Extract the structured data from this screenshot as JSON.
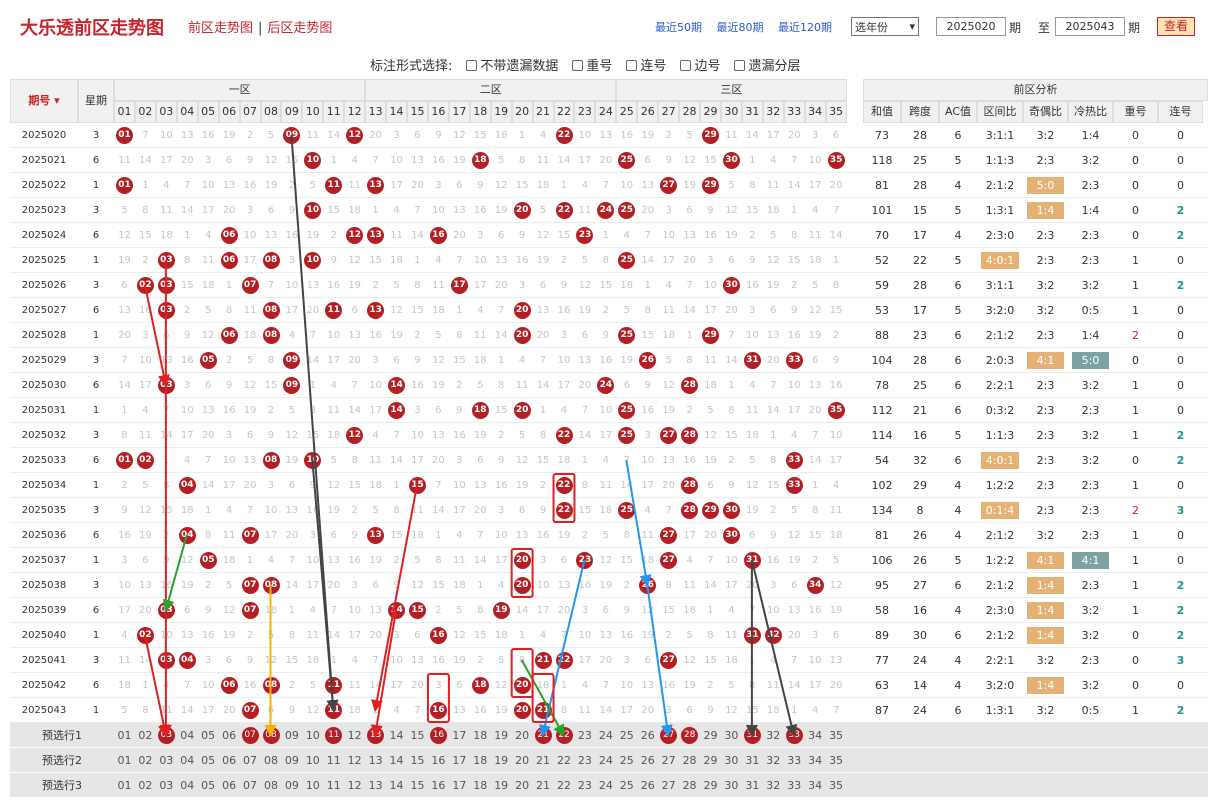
{
  "brand": "大乐透前区走势图",
  "nav": {
    "front": "前区走势图",
    "back": "后区走势图"
  },
  "quick": [
    "最近50期",
    "最近80期",
    "最近120期"
  ],
  "year_select": "选年份",
  "range": {
    "from": "2025020",
    "from_label": "期",
    "to_label": "至",
    "to": "2025043",
    "to_suffix": "期"
  },
  "view_button": "查看",
  "options": {
    "label": "标注形式选择:",
    "items": [
      "不带遗漏数据",
      "重号",
      "连号",
      "边号",
      "遗漏分层"
    ]
  },
  "header": {
    "period": "期号",
    "weekday": "星期",
    "zone1": "一区",
    "zone2": "二区",
    "zone3": "三区",
    "analysis": "前区分析",
    "numbers": [
      "01",
      "02",
      "03",
      "04",
      "05",
      "06",
      "07",
      "08",
      "09",
      "10",
      "11",
      "12",
      "13",
      "14",
      "15",
      "16",
      "17",
      "18",
      "19",
      "20",
      "21",
      "22",
      "23",
      "24",
      "25",
      "26",
      "27",
      "28",
      "29",
      "30",
      "31",
      "32",
      "33",
      "34",
      "35"
    ],
    "cols": [
      "和值",
      "跨度",
      "AC值",
      "区间比",
      "奇偶比",
      "冷热比",
      "重号",
      "连号"
    ]
  },
  "rows": [
    {
      "p": "2025020",
      "w": "3",
      "b": [
        1,
        9,
        12,
        22,
        29
      ],
      "a": [
        "73",
        "28",
        "6",
        "3:1:1",
        "3:2",
        "1:4",
        "0",
        "0"
      ]
    },
    {
      "p": "2025021",
      "w": "6",
      "b": [
        10,
        18,
        25,
        30,
        35
      ],
      "a": [
        "118",
        "25",
        "5",
        "1:1:3",
        "2:3",
        "3:2",
        "0",
        "0"
      ]
    },
    {
      "p": "2025022",
      "w": "1",
      "b": [
        1,
        11,
        13,
        27,
        29
      ],
      "a": [
        "81",
        "28",
        "4",
        "2:1:2",
        "5:0",
        "2:3",
        "0",
        "0"
      ]
    },
    {
      "p": "2025023",
      "w": "3",
      "b": [
        10,
        20,
        22,
        24,
        25
      ],
      "a": [
        "101",
        "15",
        "5",
        "1:3:1",
        "1:4",
        "1:4",
        "0",
        "2"
      ]
    },
    {
      "p": "2025024",
      "w": "6",
      "b": [
        6,
        12,
        13,
        16,
        23
      ],
      "a": [
        "70",
        "17",
        "4",
        "2:3:0",
        "2:3",
        "2:3",
        "0",
        "2"
      ]
    },
    {
      "p": "2025025",
      "w": "1",
      "b": [
        3,
        6,
        8,
        10,
        25
      ],
      "a": [
        "52",
        "22",
        "5",
        "4:0:1",
        "2:3",
        "2:3",
        "1",
        "0"
      ]
    },
    {
      "p": "2025026",
      "w": "3",
      "b": [
        2,
        7,
        17,
        30,
        3
      ],
      "a": [
        "59",
        "28",
        "6",
        "3:1:1",
        "3:2",
        "3:2",
        "1",
        "2"
      ]
    },
    {
      "p": "2025027",
      "w": "6",
      "b": [
        3,
        8,
        11,
        13,
        20
      ],
      "a": [
        "53",
        "17",
        "5",
        "3:2:0",
        "3:2",
        "0:5",
        "1",
        "0"
      ]
    },
    {
      "p": "2025028",
      "w": "1",
      "b": [
        6,
        8,
        20,
        25,
        29
      ],
      "a": [
        "88",
        "23",
        "6",
        "2:1:2",
        "2:3",
        "1:4",
        "2",
        "0"
      ]
    },
    {
      "p": "2025029",
      "w": "3",
      "b": [
        5,
        9,
        26,
        31,
        33
      ],
      "a": [
        "104",
        "28",
        "6",
        "2:0:3",
        "4:1",
        "5:0",
        "0",
        "0"
      ]
    },
    {
      "p": "2025030",
      "w": "6",
      "b": [
        3,
        9,
        14,
        24,
        28
      ],
      "a": [
        "78",
        "25",
        "6",
        "2:2:1",
        "2:3",
        "3:2",
        "1",
        "0"
      ]
    },
    {
      "p": "2025031",
      "w": "1",
      "b": [
        14,
        18,
        20,
        25,
        35
      ],
      "a": [
        "112",
        "21",
        "6",
        "0:3:2",
        "2:3",
        "2:3",
        "1",
        "0"
      ]
    },
    {
      "p": "2025032",
      "w": "3",
      "b": [
        12,
        22,
        25,
        27,
        28
      ],
      "a": [
        "114",
        "16",
        "5",
        "1:1:3",
        "2:3",
        "3:2",
        "1",
        "2"
      ]
    },
    {
      "p": "2025033",
      "w": "6",
      "b": [
        1,
        2,
        8,
        10,
        33
      ],
      "a": [
        "54",
        "32",
        "6",
        "4:0:1",
        "2:3",
        "3:2",
        "0",
        "2"
      ]
    },
    {
      "p": "2025034",
      "w": "1",
      "b": [
        4,
        15,
        22,
        28,
        33
      ],
      "a": [
        "102",
        "29",
        "4",
        "1:2:2",
        "2:3",
        "2:3",
        "1",
        "0"
      ]
    },
    {
      "p": "2025035",
      "w": "3",
      "b": [
        22,
        25,
        28,
        29,
        30
      ],
      "a": [
        "134",
        "8",
        "4",
        "0:1:4",
        "2:3",
        "2:3",
        "2",
        "3"
      ]
    },
    {
      "p": "2025036",
      "w": "6",
      "b": [
        4,
        7,
        13,
        27,
        30
      ],
      "a": [
        "81",
        "26",
        "4",
        "2:1:2",
        "3:2",
        "2:3",
        "1",
        "0"
      ]
    },
    {
      "p": "2025037",
      "w": "1",
      "b": [
        5,
        20,
        23,
        27,
        31
      ],
      "a": [
        "106",
        "26",
        "5",
        "1:2:2",
        "4:1",
        "4:1",
        "1",
        "0"
      ]
    },
    {
      "p": "2025038",
      "w": "3",
      "b": [
        7,
        8,
        20,
        26,
        34
      ],
      "a": [
        "95",
        "27",
        "6",
        "2:1:2",
        "1:4",
        "2:3",
        "1",
        "2"
      ]
    },
    {
      "p": "2025039",
      "w": "6",
      "b": [
        3,
        7,
        14,
        15,
        19
      ],
      "a": [
        "58",
        "16",
        "4",
        "2:3:0",
        "1:4",
        "3:2",
        "1",
        "2"
      ]
    },
    {
      "p": "2025040",
      "w": "1",
      "b": [
        2,
        16,
        31,
        32,
        31
      ],
      "a": [
        "89",
        "30",
        "6",
        "2:1:2",
        "1:4",
        "3:2",
        "0",
        "2"
      ]
    },
    {
      "p": "2025041",
      "w": "3",
      "b": [
        3,
        4,
        21,
        22,
        27
      ],
      "a": [
        "77",
        "24",
        "4",
        "2:2:1",
        "3:2",
        "2:3",
        "0",
        "3"
      ]
    },
    {
      "p": "2025042",
      "w": "6",
      "b": [
        6,
        8,
        11,
        18,
        20
      ],
      "a": [
        "63",
        "14",
        "4",
        "3:2:0",
        "1:4",
        "3:2",
        "0",
        "0"
      ]
    },
    {
      "p": "2025043",
      "w": "1",
      "b": [
        7,
        11,
        16,
        20,
        21
      ],
      "a": [
        "87",
        "24",
        "6",
        "1:3:1",
        "3:2",
        "0:5",
        "1",
        "2"
      ]
    }
  ],
  "pre_rows": [
    {
      "label": "预选行1",
      "sel": [
        3,
        7,
        8,
        11,
        13,
        16,
        21,
        22,
        27,
        28,
        31,
        33
      ]
    },
    {
      "label": "预选行2",
      "sel": []
    },
    {
      "label": "预选行3",
      "sel": []
    }
  ],
  "colors": {
    "brand": "#c8242b",
    "ball": "#b51f23",
    "link": "#2a5bd7",
    "highlight_orange": "#e4b274",
    "highlight_teal": "#7da2a3"
  }
}
